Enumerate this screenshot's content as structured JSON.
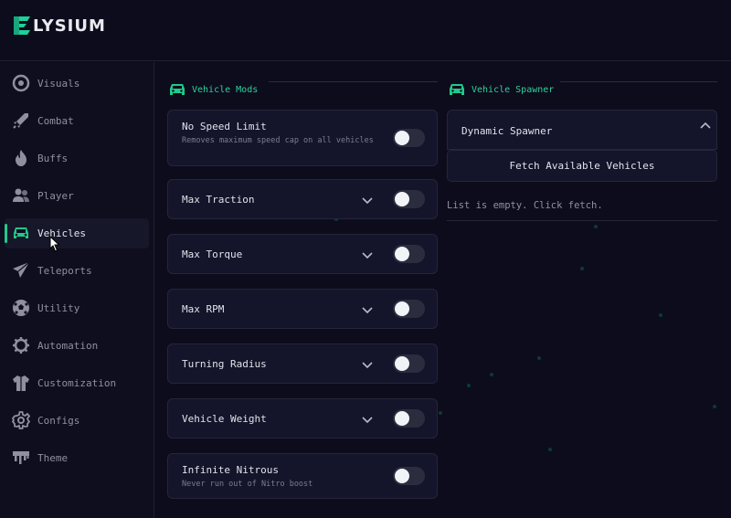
{
  "app": {
    "brand": "LYSIUM",
    "accent": "#22c98a"
  },
  "sidebar": {
    "items": [
      {
        "label": "Visuals",
        "icon": "eye-icon"
      },
      {
        "label": "Combat",
        "icon": "rocket-icon"
      },
      {
        "label": "Buffs",
        "icon": "flame-icon"
      },
      {
        "label": "Player",
        "icon": "users-icon"
      },
      {
        "label": "Vehicles",
        "icon": "car-icon",
        "active": true
      },
      {
        "label": "Teleports",
        "icon": "paper-plane-icon"
      },
      {
        "label": "Utility",
        "icon": "ball-icon"
      },
      {
        "label": "Automation",
        "icon": "cog-spike-icon"
      },
      {
        "label": "Customization",
        "icon": "jacket-icon"
      },
      {
        "label": "Configs",
        "icon": "gear-icon"
      },
      {
        "label": "Theme",
        "icon": "paint-drip-icon"
      }
    ]
  },
  "vehicle_mods": {
    "title": "Vehicle Mods",
    "cards": [
      {
        "title": "No Speed Limit",
        "desc": "Removes maximum speed cap on all vehicles",
        "expandable": false,
        "enabled": false
      },
      {
        "title": "Max Traction",
        "expandable": true,
        "enabled": false
      },
      {
        "title": "Max Torque",
        "expandable": true,
        "enabled": false
      },
      {
        "title": "Max RPM",
        "expandable": true,
        "enabled": false
      },
      {
        "title": "Turning Radius",
        "expandable": true,
        "enabled": false
      },
      {
        "title": "Vehicle Weight",
        "expandable": true,
        "enabled": false
      },
      {
        "title": "Infinite Nitrous",
        "desc": "Never run out of Nitro boost",
        "expandable": false,
        "enabled": false
      }
    ]
  },
  "vehicle_spawner": {
    "title": "Vehicle Spawner",
    "panel_title": "Dynamic Spawner",
    "fetch_label": "Fetch Available Vehicles",
    "empty_text": "List is empty. Click fetch."
  }
}
